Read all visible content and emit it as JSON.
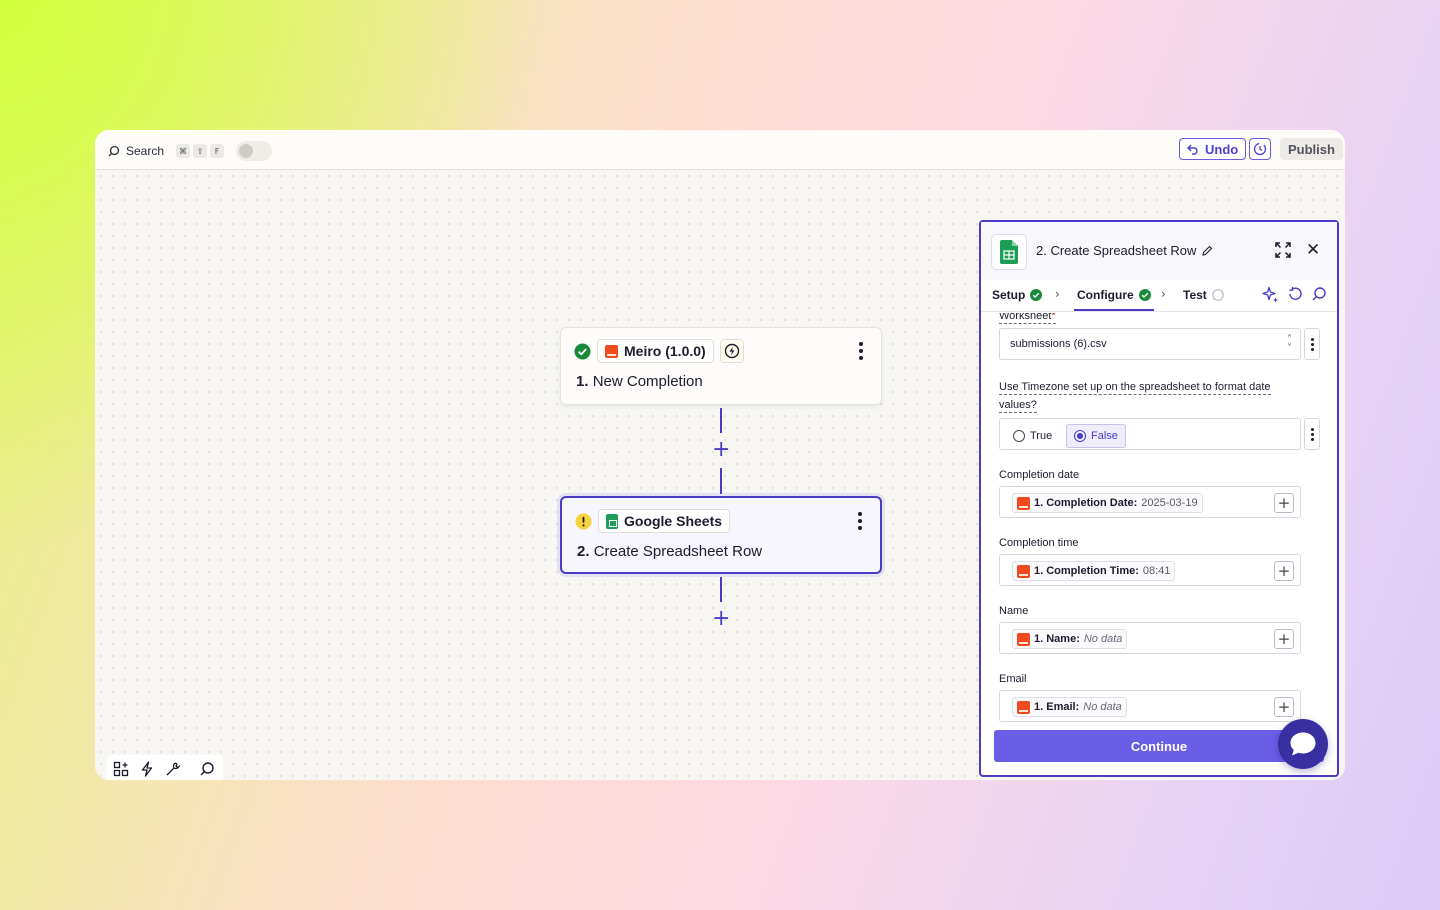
{
  "topbar": {
    "search_label": "Search",
    "shortcut_keys": [
      "⌘",
      "⇧",
      "F"
    ],
    "undo_label": "Undo",
    "publish_label": "Publish"
  },
  "nodes": [
    {
      "app": "Meiro (1.0.0)",
      "step": "1.",
      "title": "New Completion",
      "status": "success"
    },
    {
      "app": "Google Sheets",
      "step": "2.",
      "title": "Create Spreadsheet Row",
      "status": "warning"
    }
  ],
  "panel": {
    "title": "2. Create Spreadsheet Row",
    "tabs": [
      {
        "label": "Setup",
        "state": "done"
      },
      {
        "label": "Configure",
        "state": "done"
      },
      {
        "label": "Test",
        "state": "pending"
      }
    ],
    "worksheet_label": "Worksheet",
    "worksheet_required": "*",
    "worksheet_value": "submissions (6).csv",
    "timezone_label_1": "Use Timezone set up on the spreadsheet to format date",
    "timezone_label_2": "values?",
    "radio_true": "True",
    "radio_false": "False",
    "fields": [
      {
        "label": "Completion date",
        "chip_key": "1. Completion Date:",
        "chip_value": "2025-03-19",
        "no_data": false
      },
      {
        "label": "Completion time",
        "chip_key": "1. Completion Time:",
        "chip_value": "08:41",
        "no_data": false
      },
      {
        "label": "Name",
        "chip_key": "1. Name:",
        "chip_value": "No data",
        "no_data": true
      },
      {
        "label": "Email",
        "chip_key": "1. Email:",
        "chip_value": "No data",
        "no_data": true
      }
    ],
    "continue_label": "Continue"
  },
  "colors": {
    "accent": "#4a3cc4",
    "success": "#1a8a3a",
    "warning": "#f5d33c",
    "continue": "#6a5de6"
  }
}
